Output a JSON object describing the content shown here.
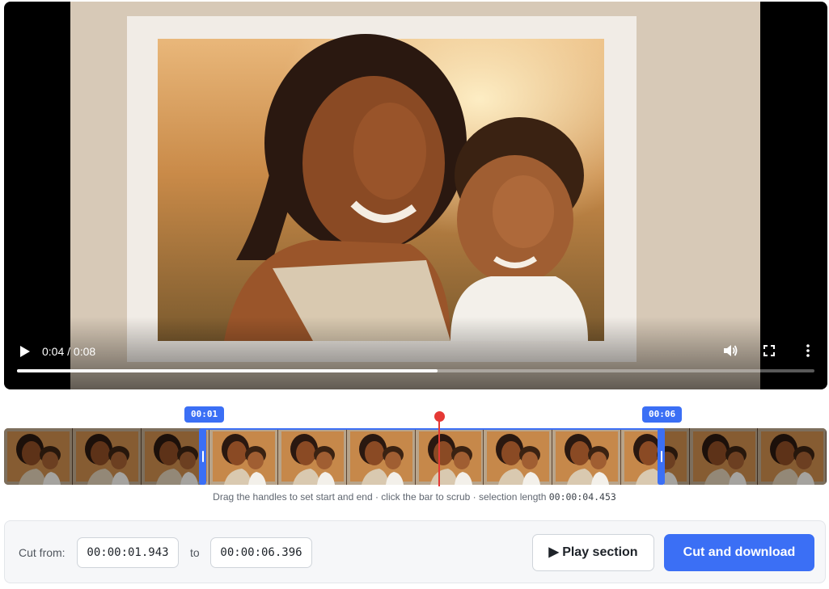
{
  "video": {
    "time_display": "0:04 / 0:08",
    "progress_fraction": 0.527,
    "controls": {
      "play": "play-icon",
      "volume": "volume-icon",
      "fullscreen": "fullscreen-icon",
      "more": "more-vert-icon"
    }
  },
  "trimmer": {
    "start_tag": "00:01",
    "end_tag": "00:06",
    "thumbnail_count": 12
  },
  "hint": {
    "text": "Drag the handles to set start and end · click the bar to scrub · selection length ",
    "length": "00:00:04.453"
  },
  "cut": {
    "from_label": "Cut from:",
    "from_value": "00:00:01.943",
    "to_label": "to",
    "to_value": "00:00:06.396",
    "play_label": "▶ Play section",
    "download_label": "Cut and download"
  },
  "colors": {
    "accent": "#3b6ff5",
    "playhead": "#e53935"
  }
}
